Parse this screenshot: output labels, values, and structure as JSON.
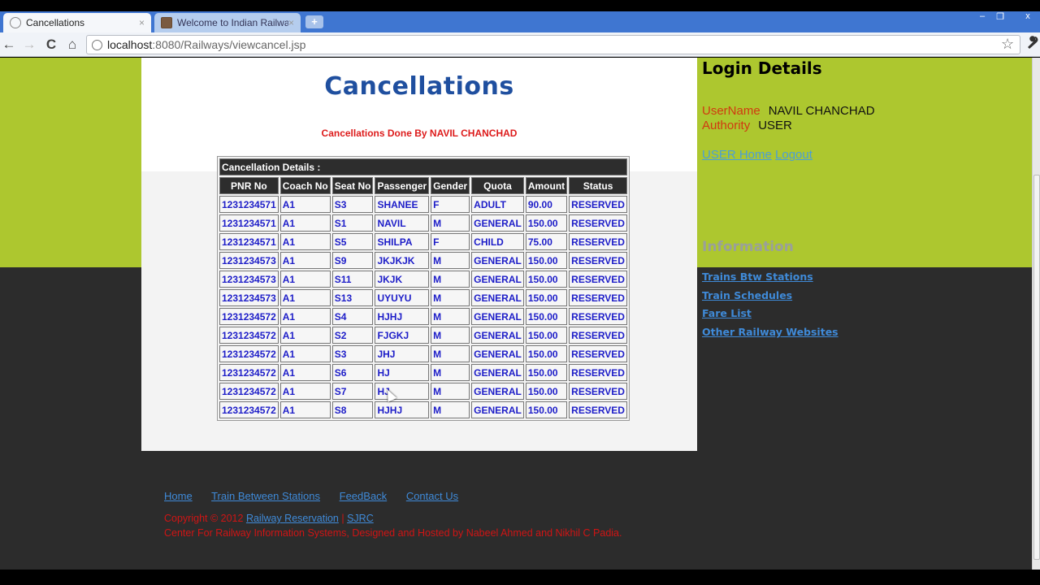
{
  "browser": {
    "tabs": [
      {
        "label": "Cancellations",
        "active": true,
        "icon": "globe-icon"
      },
      {
        "label": "Welcome to Indian Railway",
        "active": false,
        "icon": "railway-favicon-icon"
      }
    ],
    "close_glyph": "×",
    "new_tab_glyph": "+",
    "window_controls": {
      "minimize": "–",
      "maximize": "❐",
      "close": "x"
    },
    "nav": {
      "back": "←",
      "forward": "→",
      "reload": "C",
      "home": "⌂"
    },
    "url_host": "localhost",
    "url_path": ":8080/Railways/viewcancel.jsp",
    "star_glyph": "☆",
    "wrench_glyph": "🔧"
  },
  "main": {
    "title": "Cancellations",
    "subtitle": "Cancellations Done By NAVIL CHANCHAD",
    "table": {
      "caption": "Cancellation Details :",
      "columns": [
        "PNR No",
        "Coach No",
        "Seat No",
        "Passenger",
        "Gender",
        "Quota",
        "Amount",
        "Status"
      ],
      "rows": [
        [
          "1231234571",
          "A1",
          "S3",
          "SHANEE",
          "F",
          "ADULT",
          "90.00",
          "RESERVED"
        ],
        [
          "1231234571",
          "A1",
          "S1",
          "NAVIL",
          "M",
          "GENERAL",
          "150.00",
          "RESERVED"
        ],
        [
          "1231234571",
          "A1",
          "S5",
          "SHILPA",
          "F",
          "CHILD",
          "75.00",
          "RESERVED"
        ],
        [
          "1231234573",
          "A1",
          "S9",
          "JKJKJK",
          "M",
          "GENERAL",
          "150.00",
          "RESERVED"
        ],
        [
          "1231234573",
          "A1",
          "S11",
          "JKJK",
          "M",
          "GENERAL",
          "150.00",
          "RESERVED"
        ],
        [
          "1231234573",
          "A1",
          "S13",
          "UYUYU",
          "M",
          "GENERAL",
          "150.00",
          "RESERVED"
        ],
        [
          "1231234572",
          "A1",
          "S4",
          "HJHJ",
          "M",
          "GENERAL",
          "150.00",
          "RESERVED"
        ],
        [
          "1231234572",
          "A1",
          "S2",
          "FJGKJ",
          "M",
          "GENERAL",
          "150.00",
          "RESERVED"
        ],
        [
          "1231234572",
          "A1",
          "S3",
          "JHJ",
          "M",
          "GENERAL",
          "150.00",
          "RESERVED"
        ],
        [
          "1231234572",
          "A1",
          "S6",
          "HJ",
          "M",
          "GENERAL",
          "150.00",
          "RESERVED"
        ],
        [
          "1231234572",
          "A1",
          "S7",
          "HJ",
          "M",
          "GENERAL",
          "150.00",
          "RESERVED"
        ],
        [
          "1231234572",
          "A1",
          "S8",
          "HJHJ",
          "M",
          "GENERAL",
          "150.00",
          "RESERVED"
        ]
      ]
    }
  },
  "sidebar": {
    "login_title": "Login Details",
    "username_label": "UserName",
    "username_value": "NAVIL CHANCHAD",
    "authority_label": "Authority",
    "authority_value": "USER",
    "user_home_link": "USER Home",
    "logout_link": "Logout",
    "info_title": "Information",
    "info_links": [
      "Trains Btw Stations",
      "Train Schedules",
      "Fare List",
      "Other Railway Websites"
    ]
  },
  "footer": {
    "nav": [
      "Home",
      "Train Between Stations",
      "FeedBack",
      "Contact Us"
    ],
    "copyright_prefix": "Copyright © 2012 ",
    "copyright_link1": "Railway Reservation",
    "copyright_sep": " | ",
    "copyright_link2": "SJRC",
    "credits": "Center For Railway Information Systems, Designed and Hosted by Nabeel Ahmed and Nikhil C Padia."
  },
  "colors": {
    "green_band": "#adc72f",
    "dark_bg": "#2c2c2c",
    "title_blue": "#1f4f9f",
    "alert_red": "#dd1b1b",
    "cell_blue": "#1d1dc8",
    "link_blue": "#3f8ad8"
  }
}
